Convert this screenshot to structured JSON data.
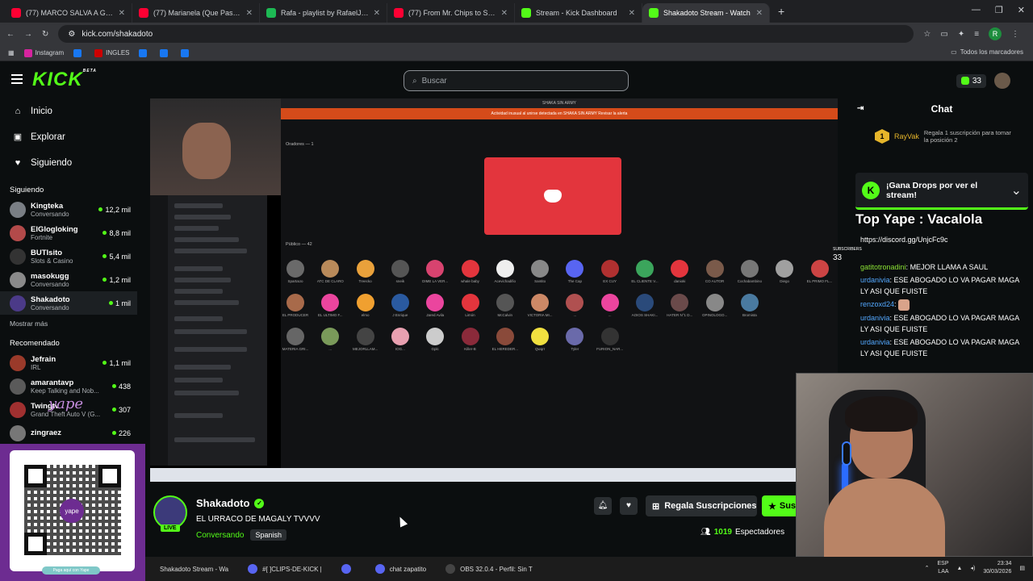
{
  "browser": {
    "tabs": [
      {
        "label": "(77) MARCO SALVA A GRACE D",
        "color": "#ff0033",
        "active": false
      },
      {
        "label": "(77) Marianela (Que Pasa) (Exte",
        "color": "#ff0033",
        "active": false
      },
      {
        "label": "Rafa - playlist by RafaelJxared |",
        "color": "#1db954",
        "active": false
      },
      {
        "label": "(77) From Mr. Chips to Scarface",
        "color": "#ff0033",
        "active": false
      },
      {
        "label": "Stream - Kick Dashboard",
        "color": "#53fc18",
        "active": false
      },
      {
        "label": "Shakadoto Stream - Watch",
        "color": "#53fc18",
        "active": true
      }
    ],
    "url": "kick.com/shakadoto",
    "profile_initial": "R",
    "bookmarks": [
      {
        "label": "Instagram",
        "color": "#d6249f"
      },
      {
        "label": "",
        "color": "#1877f2"
      },
      {
        "label": "INGLES",
        "color": "#cc0000"
      },
      {
        "label": "",
        "color": "#1877f2"
      },
      {
        "label": "",
        "color": "#1877f2"
      },
      {
        "label": "",
        "color": "#1877f2"
      }
    ],
    "all_bookmarks": "Todos los marcadores"
  },
  "header": {
    "logo": "KICK",
    "logo_beta": "BETA",
    "search_placeholder": "Buscar",
    "points": "33"
  },
  "sidebar": {
    "nav": [
      {
        "label": "Inicio",
        "icon": "⌂"
      },
      {
        "label": "Explorar",
        "icon": "▣"
      },
      {
        "label": "Siguiendo",
        "icon": "♥"
      }
    ],
    "following_title": "Siguiendo",
    "following": [
      {
        "name": "Kingteka",
        "sub": "Conversando",
        "viewers": "12,2 mil",
        "color": "#7a7f85"
      },
      {
        "name": "ElGlogloking",
        "sub": "Fortnite",
        "viewers": "8,8 mil",
        "color": "#b34a4a"
      },
      {
        "name": "BUTIsito",
        "sub": "Slots & Casino",
        "viewers": "5,4 mil",
        "color": "#333"
      },
      {
        "name": "masokugg",
        "sub": "Conversando",
        "viewers": "1,2 mil",
        "color": "#8a8a8a"
      },
      {
        "name": "Shakadoto",
        "sub": "Conversando",
        "viewers": "1 mil",
        "color": "#4b3a88"
      }
    ],
    "show_more": "Mostrar más",
    "recommended_title": "Recomendado",
    "recommended": [
      {
        "name": "Jefrain",
        "sub": "IRL",
        "viewers": "1,1 mil",
        "color": "#9a3a2a"
      },
      {
        "name": "amarantavp",
        "sub": "Keep Talking and Nob...",
        "viewers": "438",
        "color": "#5a5a5a"
      },
      {
        "name": "Twingtv",
        "sub": "Grand Theft Auto V (G...",
        "viewers": "307",
        "color": "#a03030"
      },
      {
        "name": "zingraez",
        "sub": "",
        "viewers": "226",
        "color": "#777"
      }
    ]
  },
  "yape": {
    "sticker": "yape",
    "center": "yape",
    "footer": "Paga aquí con Yape"
  },
  "video": {
    "discord_title": "SHAKA SIN ARMY",
    "discord_alert": "Actividad inusual al unirse detectada en SHAKA SIN ARMY   Revisar la alerta",
    "oradores": "Oradores — 1",
    "publico": "Público — 42",
    "users": [
      {
        "n": "SpartaUo",
        "c": "#6a6a6a"
      },
      {
        "n": "ATC DE CLARO",
        "c": "#b98a5a"
      },
      {
        "n": "Treecko",
        "c": "#e9a13b"
      },
      {
        "n": "sneik",
        "c": "#555"
      },
      {
        "n": "DIME LA VER...",
        "c": "#d8436f"
      },
      {
        "n": "whale baby",
        "c": "#e3353d"
      },
      {
        "n": "Acevichadifio",
        "c": "#eee"
      },
      {
        "n": "Santito",
        "c": "#888"
      },
      {
        "n": "The Cap",
        "c": "#5865f2"
      },
      {
        "n": "EX CUY",
        "c": "#b03030"
      },
      {
        "n": "EL CLIENTE V...",
        "c": "#3ba55c"
      },
      {
        "n": "danioki",
        "c": "#e3353d"
      },
      {
        "n": "CO AUTOR",
        "c": "#7a5a4a"
      },
      {
        "n": "Cochabambino",
        "c": "#777"
      },
      {
        "n": "Diego",
        "c": "#a0a0a0"
      },
      {
        "n": "EL PRIMO FL...",
        "c": "#c44"
      },
      {
        "n": "EL PRODUCER",
        "c": "#a86a4a"
      },
      {
        "n": "EL ULTIMO F...",
        "c": "#eb459e"
      },
      {
        "n": "elmo",
        "c": "#f0a030"
      },
      {
        "n": "J Enrique",
        "c": "#2a5aa0"
      },
      {
        "n": "Jared Avila",
        "c": "#eb459e"
      },
      {
        "n": "Limón",
        "c": "#e3353d"
      },
      {
        "n": "McCalvin",
        "c": "#555"
      },
      {
        "n": "VICTORIA MI...",
        "c": "#c86"
      },
      {
        "n": "...",
        "c": "#b05050"
      },
      {
        "n": "...",
        "c": "#eb459e"
      },
      {
        "n": "AOIOS SHAKI...",
        "c": "#2a4a7a"
      },
      {
        "n": "HATER N°1 D...",
        "c": "#6a4a4a"
      },
      {
        "n": "OPINOLOGO...",
        "c": "#888"
      },
      {
        "n": "Bromista",
        "c": "#4a7aa0"
      },
      {
        "n": "MATERIA GRI...",
        "c": "#666"
      },
      {
        "n": "...",
        "c": "#7a9a5a"
      },
      {
        "n": "MEJORLLAM...",
        "c": "#444"
      },
      {
        "n": "IOG...",
        "c": "#e8a0b0"
      },
      {
        "n": "Gplc",
        "c": "#ccc"
      },
      {
        "n": "Killer-B",
        "c": "#8a2a3a"
      },
      {
        "n": "EL HEREDER...",
        "c": "#8a4a3a"
      },
      {
        "n": "Qwqrr",
        "c": "#f0e040"
      },
      {
        "n": "Tyler",
        "c": "#6a6aaa"
      },
      {
        "n": "FURION_NAR...",
        "c": "#333"
      }
    ]
  },
  "streamer": {
    "name": "Shakadoto",
    "title": "EL URRACO DE MAGALY TVVVV",
    "category": "Conversando",
    "language": "Spanish",
    "live": "LIVE",
    "gift_label": "Regala Suscripciones",
    "sub_label": "Sus",
    "viewers": "1019",
    "viewers_label": "Espectadores"
  },
  "chat": {
    "title": "Chat",
    "pinned_rank": "1",
    "pinned_user": "RayVak",
    "pinned_sub": "Regala 1 suscripción para tomar la posición 2",
    "drops": "¡Gana Drops por ver el stream!",
    "overlay_yape": "Top Yape : Vacalola",
    "overlay_url": "https://discord.gg/UnjcFc9c",
    "subs_label": "SUBSCRIBERS",
    "subs_count": "33",
    "messages": [
      {
        "user": "gatitotronadini",
        "text": "MEJOR LLAMA A SAUL",
        "color": "green"
      },
      {
        "user": "urdanivia",
        "text": "ESE ABOGADO LO VA PAGAR MAGA LY ASI QUE FUISTE",
        "color": "blue"
      },
      {
        "user": "renzoxd24",
        "text": "",
        "color": "blue",
        "emote": true
      },
      {
        "user": "urdanivia",
        "text": "ESE ABOGADO LO VA PAGAR MAGA LY ASI QUE FUISTE",
        "color": "blue"
      },
      {
        "user": "urdanivia",
        "text": "ESE ABOGADO LO VA PAGAR MAGA LY ASI QUE FUISTE",
        "color": "blue"
      }
    ]
  },
  "taskbar": {
    "items": [
      {
        "label": "Shakadoto Stream - Wa",
        "color": "#53fc18"
      },
      {
        "label": "#[ ]CLIPS-DE-KICK |",
        "color": "#5865f2"
      },
      {
        "label": "",
        "color": "#5865f2"
      },
      {
        "label": "chat zapatito",
        "color": "#5865f2"
      },
      {
        "label": "OBS 32.0.4 - Perfil: Sin T",
        "color": "#444"
      }
    ],
    "lang": "ESP",
    "lang2": "LAA",
    "time": "23:34",
    "date": "30/03/2026"
  }
}
